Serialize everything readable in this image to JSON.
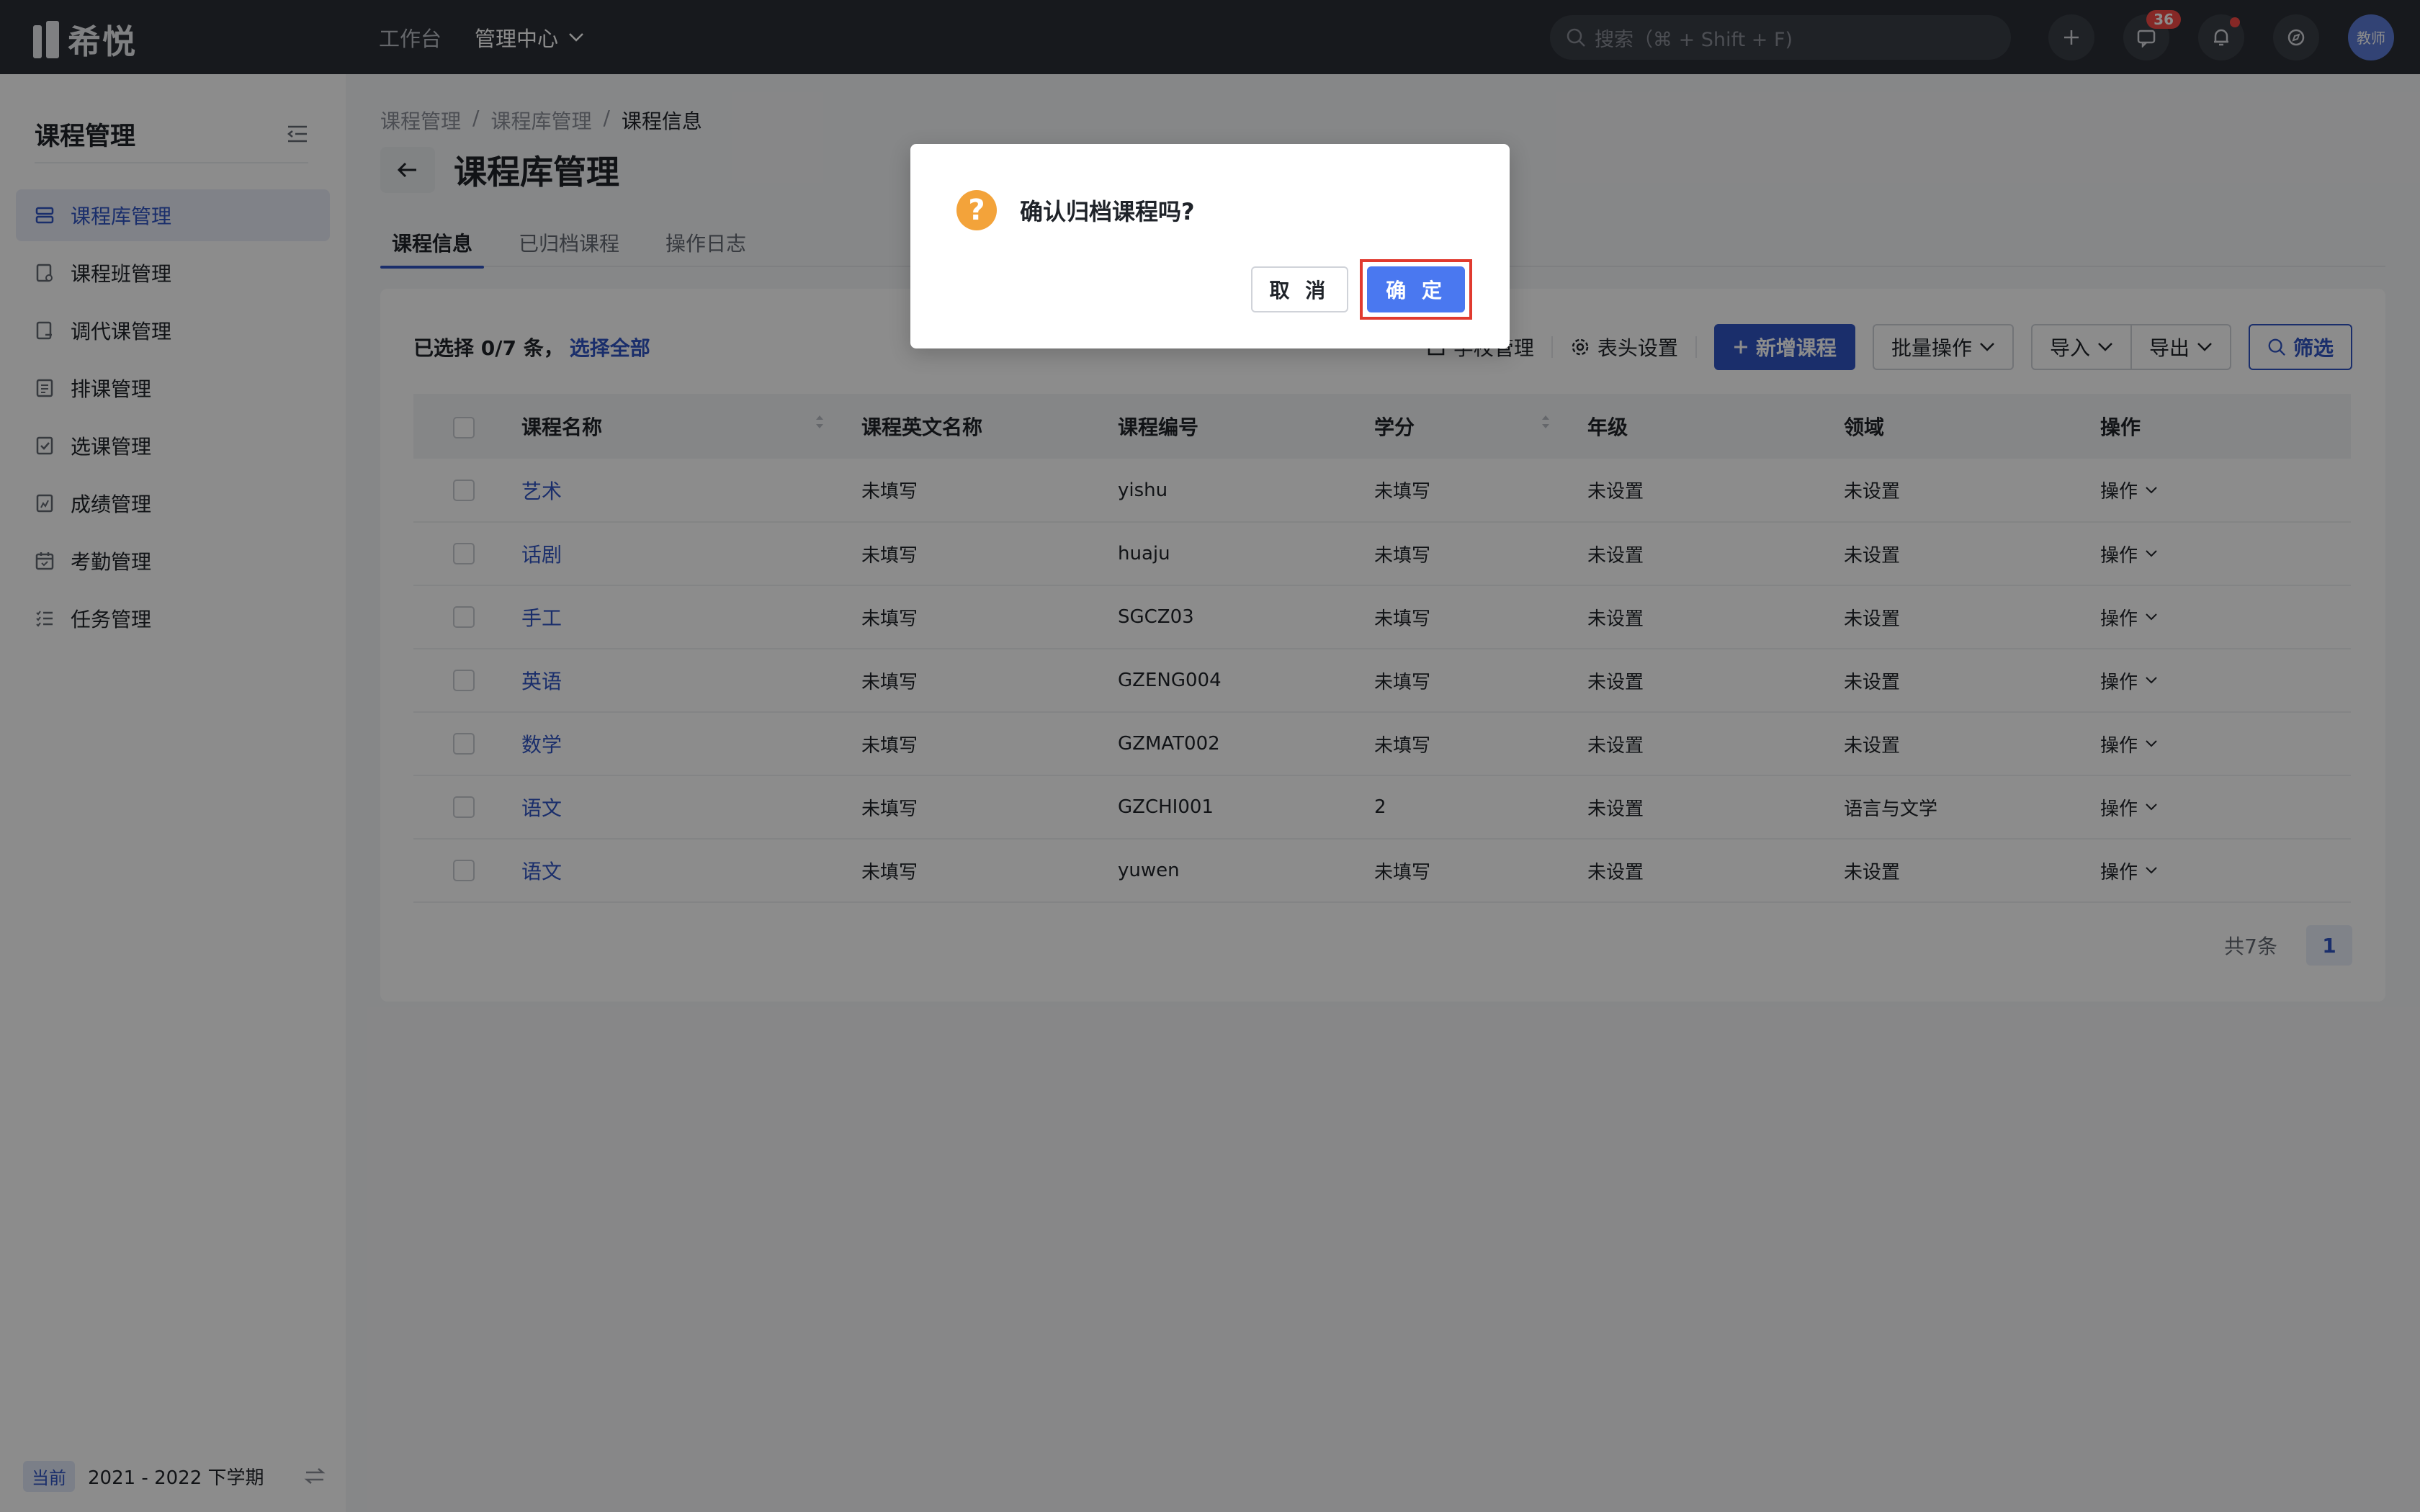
{
  "app": {
    "logo": "希悦"
  },
  "topnav": {
    "workbench": "工作台",
    "admin_center": "管理中心"
  },
  "search": {
    "placeholder": "搜索（⌘ + Shift + F)"
  },
  "top_icons": {
    "message_count": "36",
    "avatar_label": "教师"
  },
  "sidebar": {
    "title": "课程管理",
    "items": [
      {
        "label": "课程库管理"
      },
      {
        "label": "课程班管理"
      },
      {
        "label": "调代课管理"
      },
      {
        "label": "排课管理"
      },
      {
        "label": "选课管理"
      },
      {
        "label": "成绩管理"
      },
      {
        "label": "考勤管理"
      },
      {
        "label": "任务管理"
      }
    ],
    "term_tag": "当前",
    "term": "2021 - 2022 下学期"
  },
  "breadcrumb": [
    "课程管理",
    "课程库管理",
    "课程信息"
  ],
  "page_title": "课程库管理",
  "tabs": [
    {
      "label": "课程信息"
    },
    {
      "label": "已归档课程"
    },
    {
      "label": "操作日志"
    }
  ],
  "toolbar": {
    "selected": "已选择 0/7 条，",
    "select_all": "选择全部",
    "school_mgmt": "学校管理",
    "header_settings": "表头设置",
    "add_course": "新增课程",
    "batch_ops": "批量操作",
    "import": "导入",
    "export": "导出",
    "filter": "筛选"
  },
  "table": {
    "headers": [
      "课程名称",
      "课程英文名称",
      "课程编号",
      "学分",
      "年级",
      "领域",
      "操作"
    ],
    "rows": [
      {
        "name": "艺术",
        "en": "未填写",
        "code": "yishu",
        "credit": "未填写",
        "grade": "未设置",
        "domain": "未设置",
        "op": "操作"
      },
      {
        "name": "话剧",
        "en": "未填写",
        "code": "huaju",
        "credit": "未填写",
        "grade": "未设置",
        "domain": "未设置",
        "op": "操作"
      },
      {
        "name": "手工",
        "en": "未填写",
        "code": "SGCZ03",
        "credit": "未填写",
        "grade": "未设置",
        "domain": "未设置",
        "op": "操作"
      },
      {
        "name": "英语",
        "en": "未填写",
        "code": "GZENG004",
        "credit": "未填写",
        "grade": "未设置",
        "domain": "未设置",
        "op": "操作"
      },
      {
        "name": "数学",
        "en": "未填写",
        "code": "GZMAT002",
        "credit": "未填写",
        "grade": "未设置",
        "domain": "未设置",
        "op": "操作"
      },
      {
        "name": "语文",
        "en": "未填写",
        "code": "GZCHI001",
        "credit": "2",
        "grade": "未设置",
        "domain": "语言与文学",
        "op": "操作"
      },
      {
        "name": "语文",
        "en": "未填写",
        "code": "yuwen",
        "credit": "未填写",
        "grade": "未设置",
        "domain": "未设置",
        "op": "操作"
      }
    ]
  },
  "pager": {
    "total": "共7条",
    "current": "1"
  },
  "dialog": {
    "message": "确认归档课程吗?",
    "cancel": "取 消",
    "ok": "确 定"
  },
  "colors": {
    "primary": "#3054c4",
    "topbar": "#2b2f36",
    "warning": "#f3a33a",
    "highlight": "#e03a2f"
  }
}
